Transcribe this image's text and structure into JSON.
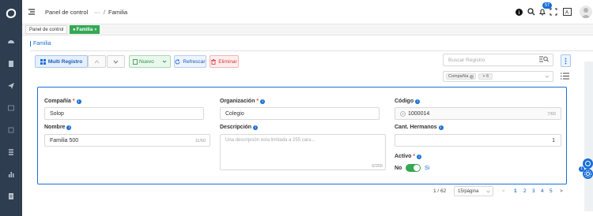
{
  "breadcrumb": {
    "root": "Panel de control",
    "ellipsis": "···",
    "separator": "/",
    "current": "Familia"
  },
  "topbar": {
    "notification_count": "57"
  },
  "tabs": [
    {
      "label": "Panel de control"
    },
    {
      "label": "Familia",
      "prefix": "●"
    }
  ],
  "panel": {
    "title": "Familia"
  },
  "toolbar": {
    "multi_registro": "Multi Registro",
    "nuevo": "Nuevo",
    "refrescar": "Refrescar",
    "eliminar": "Eliminar"
  },
  "search": {
    "placeholder": "Buscar Registro"
  },
  "filter": {
    "tag": "Compañía",
    "more": "+ 6"
  },
  "form": {
    "compania": {
      "label": "Compañía",
      "value": "Solop"
    },
    "organizacion": {
      "label": "Organización",
      "value": "Colegio"
    },
    "codigo": {
      "label": "Código",
      "value": "1000014",
      "counter": "7/60"
    },
    "nombre": {
      "label": "Nombre",
      "value": "Familia 500",
      "counter": "11/60"
    },
    "descripcion": {
      "label": "Descripción",
      "placeholder": "Una descripción esta limitada a 255 cara...",
      "counter": "0/255"
    },
    "cant_hermanos": {
      "label": "Cant. Hermanos",
      "value": "1"
    },
    "activo": {
      "label": "Activo",
      "off": "No",
      "on": "Si",
      "state": true
    }
  },
  "pagination": {
    "summary": "1 / 62",
    "page_size": "15/página",
    "pages": [
      "1",
      "2",
      "3",
      "4",
      "5"
    ],
    "current": "1",
    "prev": "<",
    "next": ">"
  },
  "colors": {
    "sidebar": "#2e3d4f",
    "accent": "#1a6fd6",
    "green": "#34a853",
    "danger": "#e84a4a"
  }
}
